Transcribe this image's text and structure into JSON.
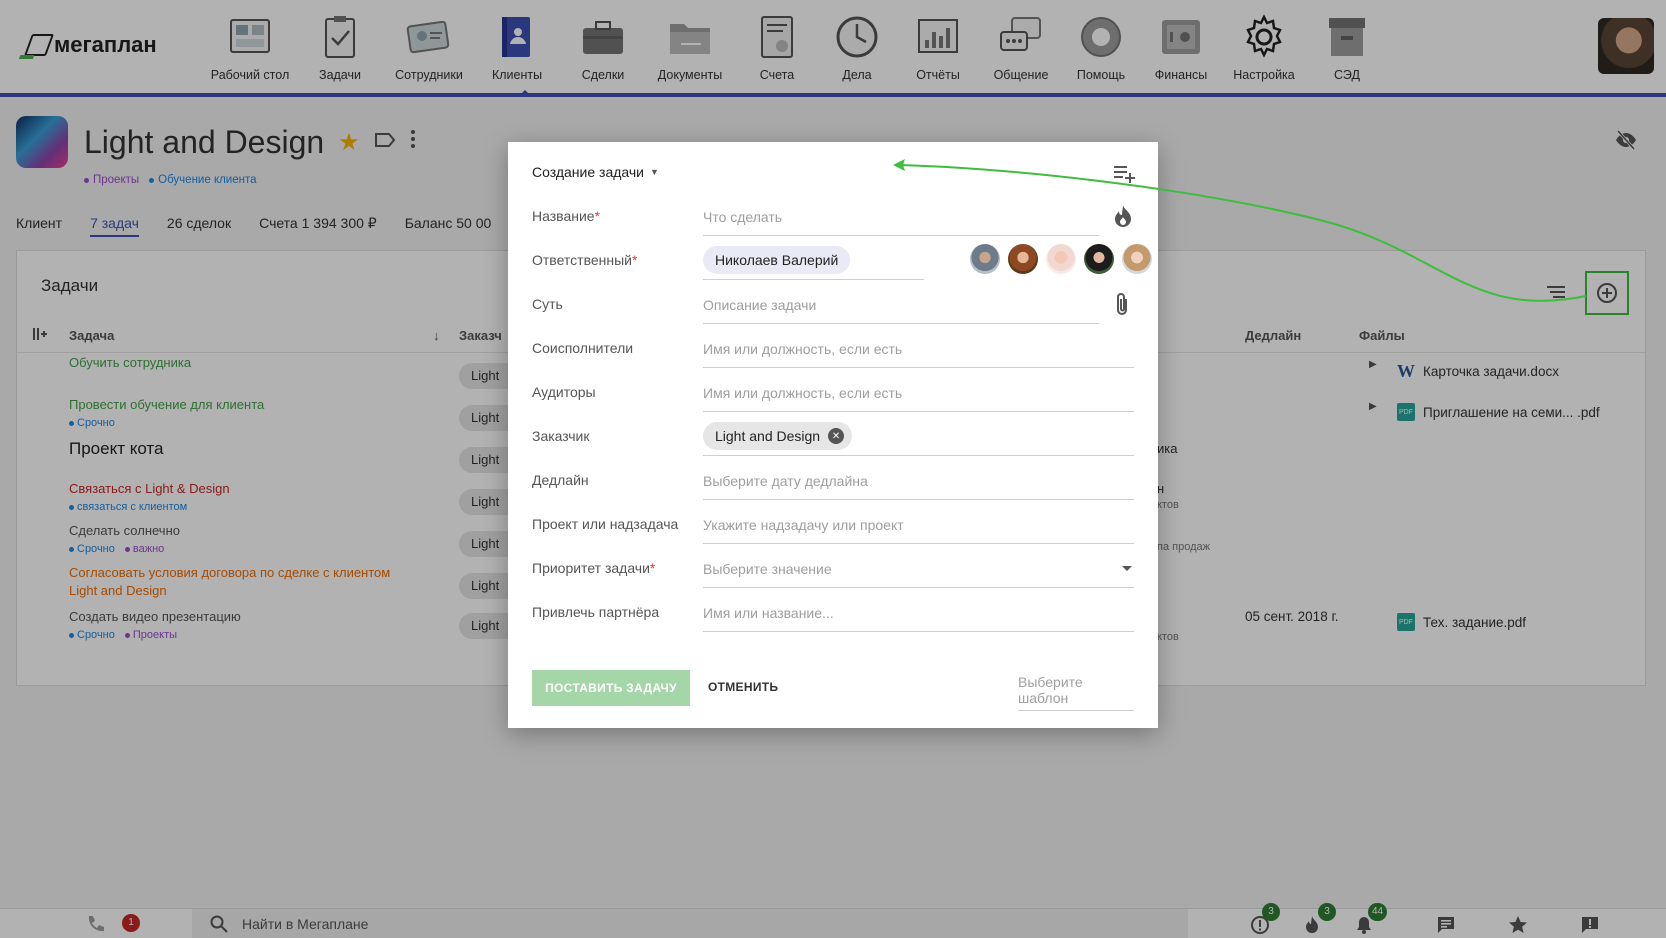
{
  "app": {
    "logo": "мегаплан"
  },
  "nav": [
    {
      "label": "Рабочий стол",
      "icon": "desktop-icon"
    },
    {
      "label": "Задачи",
      "icon": "tasks-icon"
    },
    {
      "label": "Сотрудники",
      "icon": "employees-icon"
    },
    {
      "label": "Клиенты",
      "icon": "clients-icon",
      "active": true
    },
    {
      "label": "Сделки",
      "icon": "deals-icon"
    },
    {
      "label": "Документы",
      "icon": "documents-icon"
    },
    {
      "label": "Счета",
      "icon": "invoices-icon"
    },
    {
      "label": "Дела",
      "icon": "clock-icon"
    },
    {
      "label": "Отчёты",
      "icon": "reports-icon"
    },
    {
      "label": "Общение",
      "icon": "chat-icon"
    },
    {
      "label": "Помощь",
      "icon": "lifebuoy-icon"
    },
    {
      "label": "Финансы",
      "icon": "safe-icon"
    },
    {
      "label": "Настройка",
      "icon": "gear-icon"
    },
    {
      "label": "СЭД",
      "icon": "archive-icon"
    }
  ],
  "client": {
    "name": "Light and Design",
    "tags": [
      {
        "label": "Проекты",
        "color": "#9c4dcc"
      },
      {
        "label": "Обучение клиента",
        "color": "#1e88e5"
      }
    ]
  },
  "subtabs": [
    "Клиент",
    "7 задач",
    "26 сделок",
    "Счета 1 394 300 ₽",
    "Баланс 50 00"
  ],
  "tasks": {
    "title": "Задачи",
    "columns": {
      "task": "Задача",
      "customer": "Заказч",
      "deadline": "Дедлайн",
      "files": "Файлы"
    },
    "rows": [
      {
        "name": "Обучить сотрудника",
        "color": "#43a047",
        "chip": "Light a",
        "tags": [],
        "file": "Карточка задачи.docx",
        "file_type": "word"
      },
      {
        "name": "Провести обучение для клиента",
        "color": "#43a047",
        "chip": "Light a",
        "tags": [
          {
            "label": "Срочно",
            "color": "#1e88e5"
          }
        ],
        "file": "Приглашение на семи...  .pdf",
        "file_type": "pdf"
      },
      {
        "name": "Проект кота",
        "color": "#222",
        "chip": "Light a",
        "tags": [],
        "mid": "ика"
      },
      {
        "name": "Связаться с Light & Design",
        "color": "#c62828",
        "chip": "Light a",
        "tags": [
          {
            "label": "связаться с клиентом",
            "color": "#1e88e5"
          }
        ],
        "mid": "н",
        "mid2": "ктов"
      },
      {
        "name": "Сделать солнечно",
        "color": "#555",
        "chip": "Light a",
        "tags": [
          {
            "label": "Срочно",
            "color": "#1e88e5"
          },
          {
            "label": "важно",
            "color": "#9c4dcc"
          }
        ],
        "mid": "",
        "mid2": "па продаж"
      },
      {
        "name": "Согласовать условия договора по сделке с клиентом",
        "name2": "Light and Design",
        "color": "#ef6c00",
        "chip": "Light a",
        "tags": []
      },
      {
        "name": "Создать видео презентацию",
        "color": "#555",
        "chip": "Light a",
        "tags": [
          {
            "label": "Срочно",
            "color": "#1e88e5"
          },
          {
            "label": "Проекты",
            "color": "#9c4dcc"
          }
        ],
        "mid": "",
        "mid2": "ктов",
        "deadline": "05 сент. 2018 г.",
        "file": "Тех. задание.pdf",
        "file_type": "pdf"
      }
    ]
  },
  "modal": {
    "title": "Создание задачи",
    "fields": {
      "name": {
        "label": "Название",
        "required": true,
        "placeholder": "Что сделать"
      },
      "responsible": {
        "label": "Ответственный",
        "required": true,
        "value": "Николаев Валерий"
      },
      "essence": {
        "label": "Суть",
        "placeholder": "Описание задачи"
      },
      "coexecutors": {
        "label": "Соисполнители",
        "placeholder": "Имя или должность, если есть"
      },
      "auditors": {
        "label": "Аудиторы",
        "placeholder": "Имя или должность, если есть"
      },
      "customer": {
        "label": "Заказчик",
        "value": "Light and Design"
      },
      "deadline": {
        "label": "Дедлайн",
        "placeholder": "Выберите дату дедлайна"
      },
      "project": {
        "label": "Проект или надзадача",
        "placeholder": "Укажите надзадачу или проект"
      },
      "priority": {
        "label": "Приоритет задачи",
        "required": true,
        "placeholder": "Выберите значение"
      },
      "partner": {
        "label": "Привлечь партнёра",
        "placeholder": "Имя или название..."
      }
    },
    "submit": "ПОСТАВИТЬ ЗАДАЧУ",
    "cancel": "ОТМЕНИТЬ",
    "template": "Выберите шаблон"
  },
  "bottombar": {
    "missed_calls": "1",
    "search_placeholder": "Найти в Мегаплане",
    "badges": {
      "alerts": "3",
      "hot": "3",
      "notifications": "44"
    }
  },
  "colors": {
    "accent": "#3f51b5",
    "green": "#43a047",
    "highlight": "#3ebd3e"
  }
}
